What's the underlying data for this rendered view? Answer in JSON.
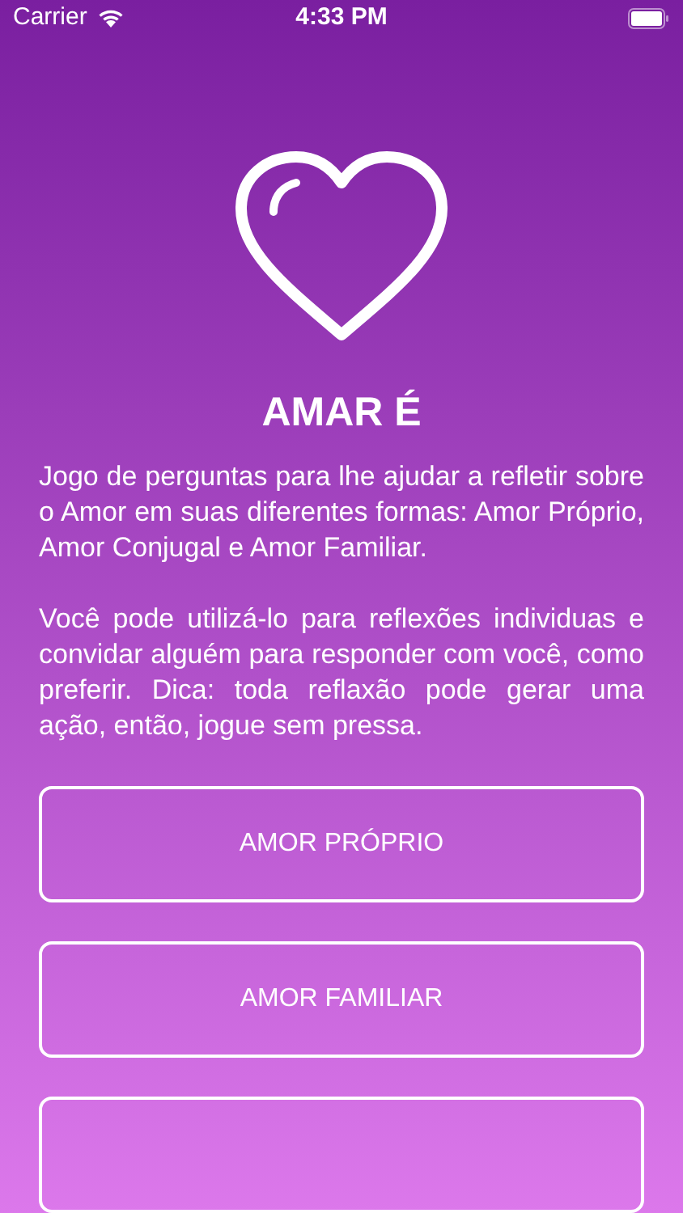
{
  "status_bar": {
    "carrier": "Carrier",
    "time": "4:33 PM"
  },
  "title": "AMAR É",
  "paragraphs": [
    "Jogo de perguntas para lhe ajudar a refletir sobre o Amor em suas diferentes formas: Amor Próprio, Amor Conjugal e Amor Familiar.",
    "Você pode utilizá-lo para reflexões individuas e convidar alguém para responder com você, como preferir. Dica: toda reflaxão pode gerar uma ação, então, jogue sem pressa."
  ],
  "buttons": [
    {
      "kind": "full",
      "label": "AMOR PRÓPRIO"
    },
    {
      "kind": "full",
      "label": "AMOR FAMILIAR"
    },
    {
      "kind": "cut"
    }
  ]
}
